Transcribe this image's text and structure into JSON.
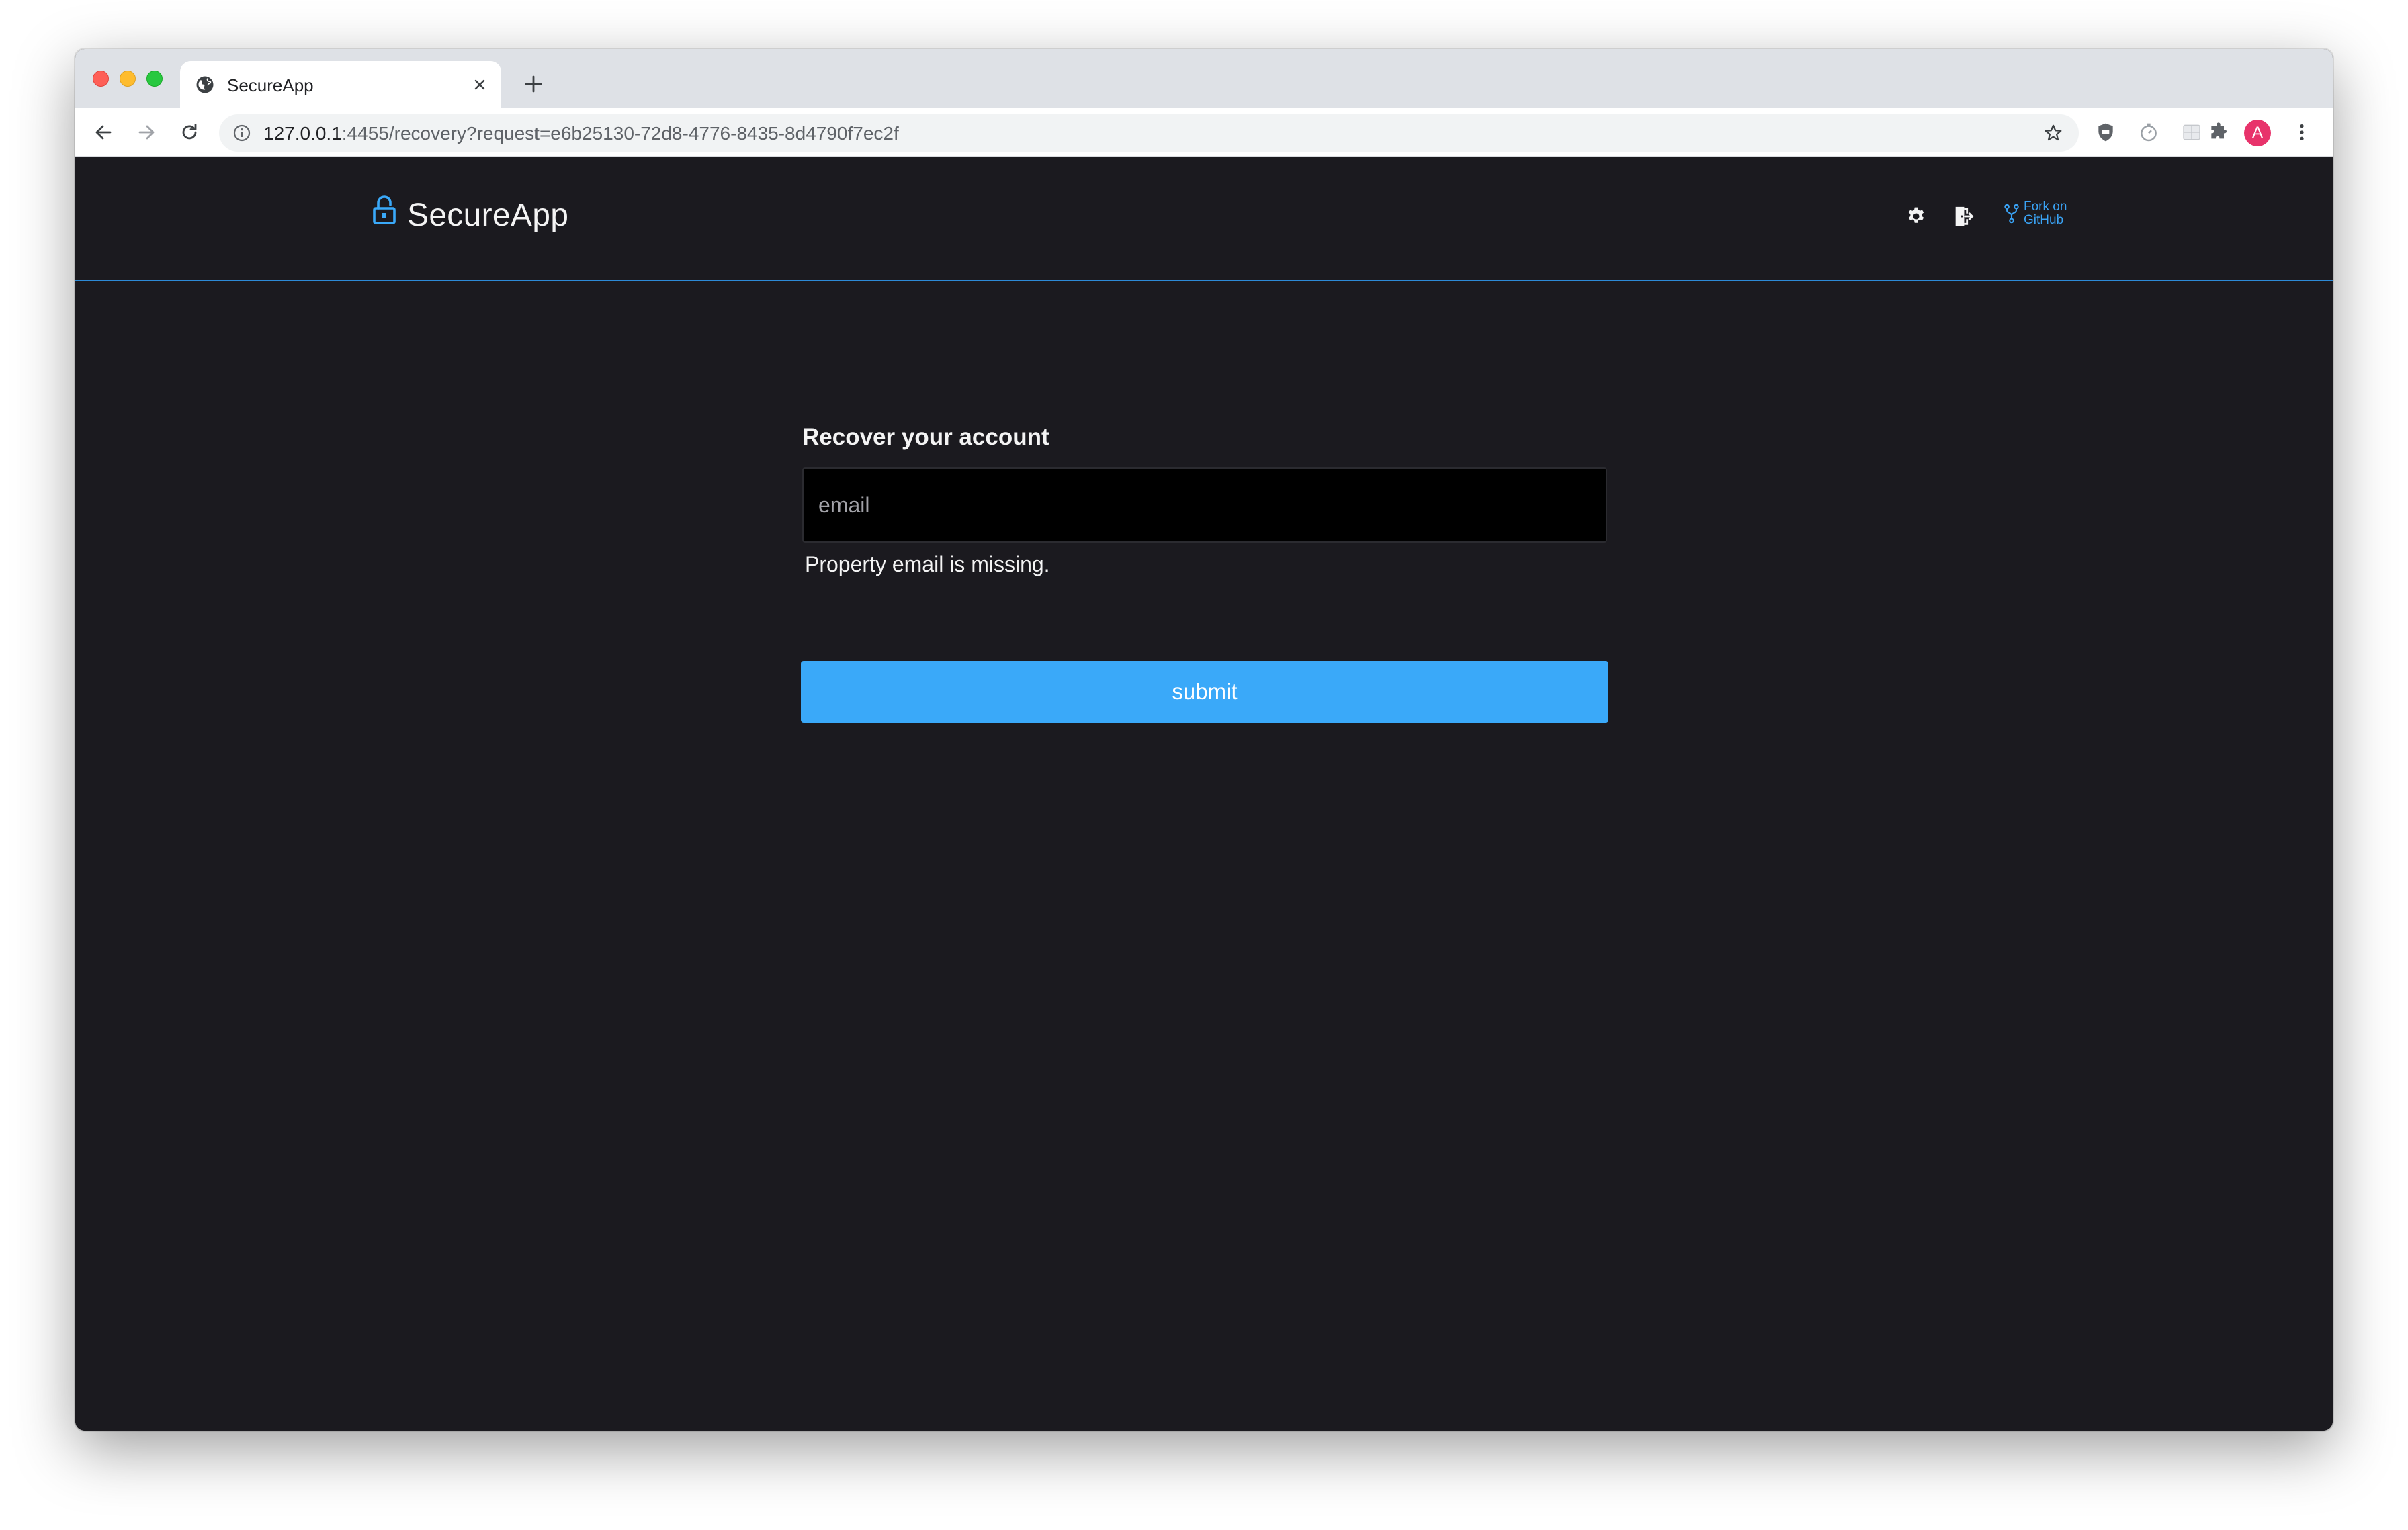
{
  "browser": {
    "tab_title": "SecureApp",
    "url_host": "127.0.0.1",
    "url_rest": ":4455/recovery?request=e6b25130-72d8-4776-8435-8d4790f7ec2f",
    "profile_initial": "A",
    "profile_color": "#e8336b"
  },
  "app": {
    "brand": "SecureApp",
    "fork_line1": "Fork on",
    "fork_line2": "GitHub",
    "accent_color": "#3aa9f9",
    "background_color": "#1b1a1f"
  },
  "recovery": {
    "title": "Recover your account",
    "email_placeholder": "email",
    "email_value": "",
    "error_message": "Property email is missing.",
    "submit_label": "submit"
  }
}
